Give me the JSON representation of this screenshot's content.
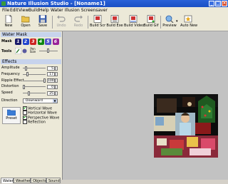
{
  "window": {
    "title": "Nature Illusion Studio - [Noname1]"
  },
  "menu": [
    "File",
    "Edit",
    "View",
    "Build",
    "Help",
    "Water Illusion Screensaver"
  ],
  "toolbar": {
    "new": "New",
    "open": "Open",
    "save": "Save",
    "undo": "Undo",
    "redo": "Redo",
    "build_scr": "Build Scr",
    "build_exe": "Build Exe",
    "build_video": "Build Video",
    "build_gif": "Build Gif",
    "preview": "Preview",
    "auto_new": "Auto New"
  },
  "water_mask": {
    "title": "Water Mask",
    "mask_label": "Mask",
    "tools_label": "Tools",
    "pen_size_label": "Pen Size",
    "mask_numbers": [
      "1",
      "2",
      "3",
      "4",
      "5",
      "6"
    ],
    "mask_colors": [
      "#1a1a6a",
      "#2244cc",
      "#cc2222",
      "#118811",
      "#5555cc",
      "#992299"
    ]
  },
  "effects": {
    "title": "Effects",
    "params": [
      {
        "label": "Amplitude",
        "value": "5",
        "level": 0.1
      },
      {
        "label": "Frequency",
        "value": "17",
        "level": 0.17
      },
      {
        "label": "Ripple Effect",
        "value": "100",
        "level": 1.0
      },
      {
        "label": "Distortion",
        "value": "0",
        "level": 0.0
      },
      {
        "label": "Speed",
        "value": "25",
        "level": 0.25
      }
    ],
    "direction_label": "Direction",
    "direction_value": "Downward",
    "checkboxes": [
      {
        "label": "Vertical Wave",
        "checked": true
      },
      {
        "label": "Horizontal Wave",
        "checked": false
      },
      {
        "label": "Perspective Wave",
        "checked": true
      },
      {
        "label": "Reflection",
        "checked": false
      }
    ],
    "preset_label": "Preset"
  },
  "tabs": [
    "Water",
    "Weather",
    "Objects",
    "Sound"
  ],
  "active_tab": "Water"
}
